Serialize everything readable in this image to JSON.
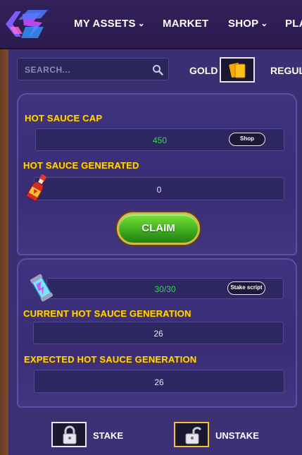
{
  "nav": {
    "items": [
      {
        "label": "MY ASSETS",
        "dropdown": true
      },
      {
        "label": "MARKET",
        "dropdown": false
      },
      {
        "label": "SHOP",
        "dropdown": true
      },
      {
        "label": "PLA",
        "dropdown": false
      }
    ]
  },
  "search": {
    "placeholder": "SEARCH...",
    "icon": "search-icon"
  },
  "tabs": {
    "gold": "GOLD",
    "regular": "REGUL..."
  },
  "panel1": {
    "cap_label": "HOT SAUCE CAP",
    "cap_value": "450",
    "shop_button": "Shop",
    "generated_label": "HOT SAUCE GENERATED",
    "generated_value": "0",
    "claim_button": "CLAIM"
  },
  "panel2": {
    "staked_value": "30/30",
    "stake_script_button": "Stake script",
    "current_label": "CURRENT HOT SAUCE GENERATION",
    "current_value": "26",
    "expected_label": "EXPECTED HOT SAUCE GENERATION",
    "expected_value": "26"
  },
  "actions": {
    "stake": "STAKE",
    "unstake": "UNSTAKE"
  },
  "colors": {
    "accent_yellow": "#ffd21f",
    "value_green": "#2ddc4a",
    "claim_green": "#3fae1f"
  }
}
